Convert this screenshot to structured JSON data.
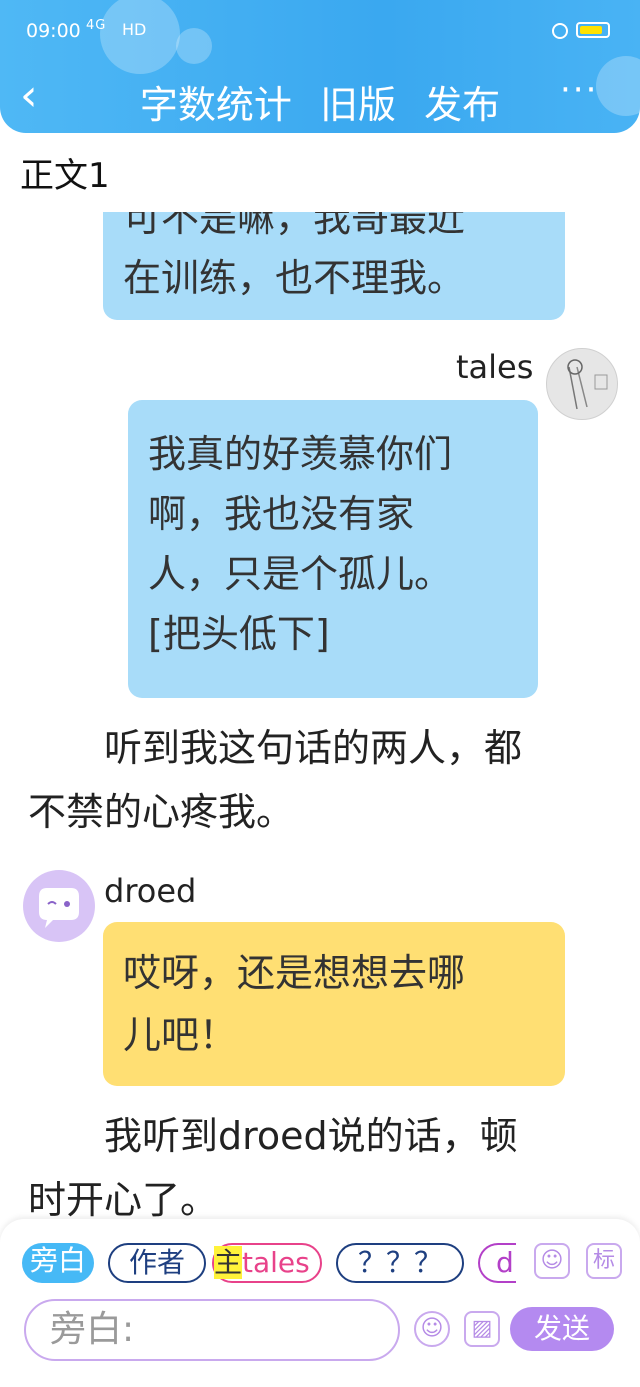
{
  "status_bar": {
    "time": "09:00",
    "signal": "4G",
    "network": "HD"
  },
  "nav": {
    "back_icon": "‹",
    "title_left": "字数统计",
    "title_mid": "旧版",
    "title_right": "发布",
    "more_icon": "···"
  },
  "section": {
    "label": "正文1"
  },
  "messages": {
    "top_partial_line1": "可不是嘛，我哥最近",
    "top_partial_line2": "在训练，也不理我。",
    "tales_name": "tales",
    "tales_lines": [
      "我真的好羡慕你们",
      "啊，我也没有家",
      "人，只是个孤儿。",
      "[把头低下]"
    ],
    "narration1_line1": "　　听到我这句话的两人，都",
    "narration1_line2": "不禁的心疼我。",
    "droed_name": "droed",
    "droed_lines": [
      "哎呀，还是想想去哪",
      "儿吧！"
    ],
    "narration2_line1": "　　我听到droed说的话，顿",
    "narration2_line2": "时开心了。"
  },
  "toolbar": {
    "chips": [
      "旁白",
      "作者",
      "主",
      "tales",
      "？？？",
      "d"
    ],
    "input_placeholder": "旁白:",
    "send_label": "发送"
  },
  "colors": {
    "header": "#3aa8f0",
    "blue_bubble": "#a8dcf9",
    "yellow_bubble": "#ffdf73",
    "accent_purple": "#b48af0"
  }
}
